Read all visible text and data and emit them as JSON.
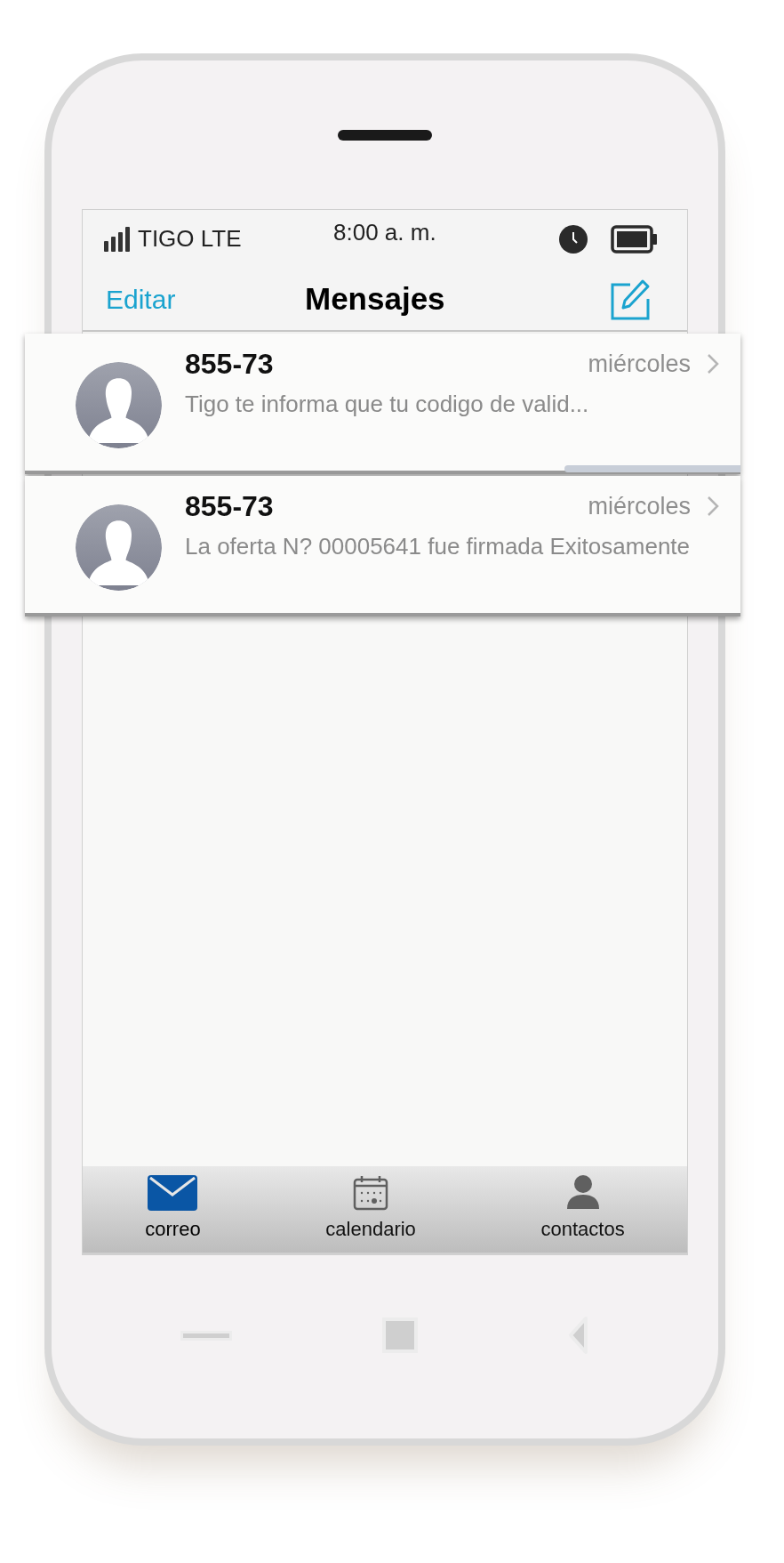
{
  "status_bar": {
    "carrier": "TIGO LTE",
    "time": "8:00 a. m."
  },
  "nav_bar": {
    "left_button": "Editar",
    "title": "Mensajes"
  },
  "messages": [
    {
      "sender": "855-73",
      "date": "miércoles",
      "preview": "Tigo te informa que tu codigo de valid..."
    },
    {
      "sender": "855-73",
      "date": "miércoles",
      "preview": "La oferta N? 00005641 fue firmada Exitosamente"
    }
  ],
  "tabs": [
    {
      "label": "correo",
      "kind": "mail",
      "selected": true
    },
    {
      "label": "calendario",
      "kind": "calendar",
      "selected": false
    },
    {
      "label": "contactos",
      "kind": "person",
      "selected": false
    }
  ]
}
